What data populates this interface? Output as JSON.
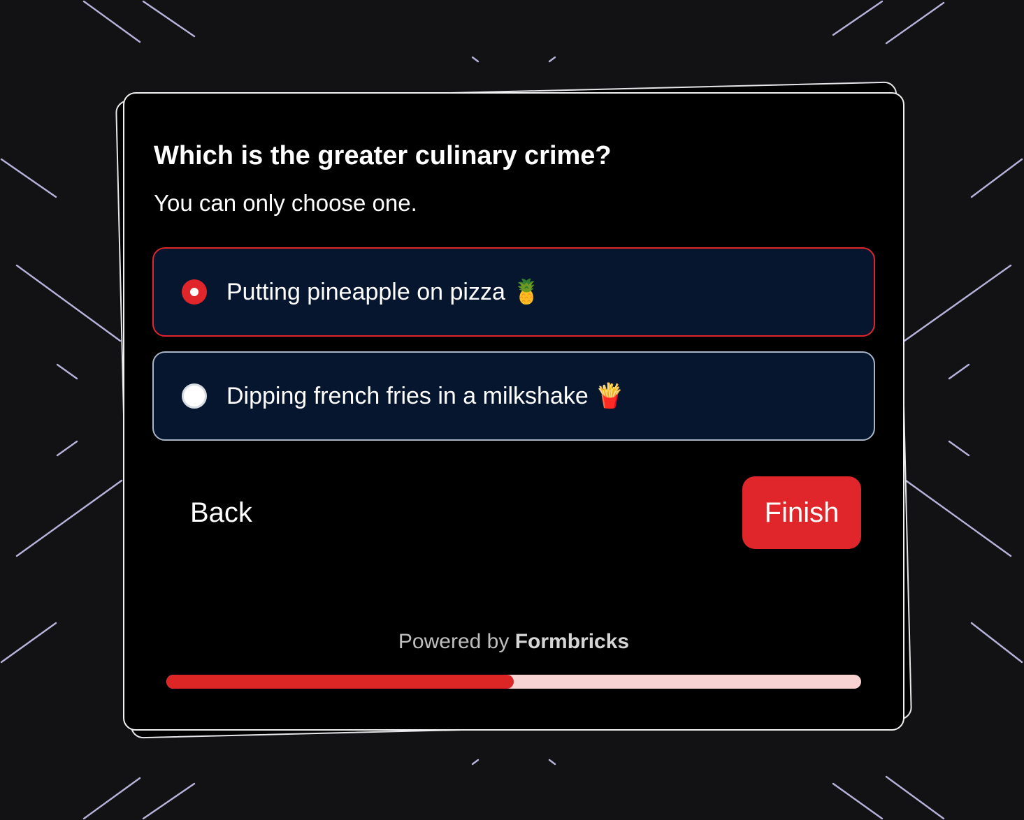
{
  "colors": {
    "background": "#121214",
    "card": "#000000",
    "accent": "#e0262a",
    "option_bg": "#06162f",
    "progress_track": "#f7d3d4",
    "bg_line": "#c9c6f2"
  },
  "survey": {
    "question": "Which is the greater culinary crime?",
    "subheader": "You can only choose one.",
    "options": [
      {
        "label": "Putting pineapple on pizza 🍍",
        "selected": true
      },
      {
        "label": "Dipping french fries in a milkshake 🍟",
        "selected": false
      }
    ],
    "back_label": "Back",
    "finish_label": "Finish",
    "powered_by_prefix": "Powered by ",
    "powered_by_brand": "Formbricks",
    "progress_fraction": 0.5
  }
}
